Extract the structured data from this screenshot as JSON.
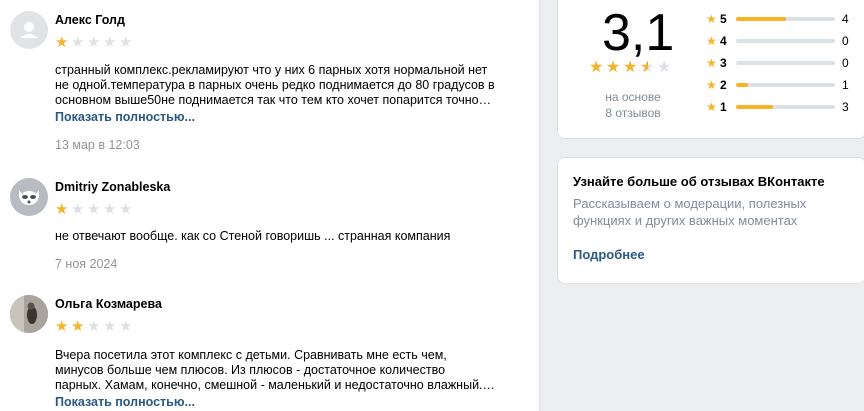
{
  "reviews": [
    {
      "author": "Алекс Голд",
      "rating": 1,
      "text": "странный комплекс.рекламируют что у них 6 парных хотя нормальной нет\nне одной.температура в парных очень редко поднимается до 80 градусов в\nосновном выше50не поднимается так что тем кто хочет попарится точно…",
      "more": "Показать полностью...",
      "date": "13 мар в 12:03"
    },
    {
      "author": "Dmitriy Zonableska",
      "rating": 1,
      "text": "не отвечают вообще. как со Стеной говоришь ... странная компания",
      "date": "7 ноя 2024"
    },
    {
      "author": "Ольга Козмарева",
      "rating": 2,
      "text": "Вчера посетила этот комплекс с детьми. Сравнивать мне есть чем,\nминусов больше чем плюсов. Из плюсов - достаточное количество\nпарных. Хамам, конечно, смешной - маленький и недостаточно влажный.…",
      "more": "Показать полностью..."
    }
  ],
  "summary": {
    "average": "3,1",
    "average_value": 3.1,
    "based_on": "на основе",
    "reviews_count": "8 отзывов",
    "distribution": [
      {
        "stars": "5",
        "count": "4",
        "fraction": 0.5
      },
      {
        "stars": "4",
        "count": "0",
        "fraction": 0
      },
      {
        "stars": "3",
        "count": "0",
        "fraction": 0
      },
      {
        "stars": "2",
        "count": "1",
        "fraction": 0.125
      },
      {
        "stars": "1",
        "count": "3",
        "fraction": 0.375
      }
    ]
  },
  "info": {
    "title": "Узнайте больше об отзывах ВКонтакте",
    "text": "Рассказываем о модерации, полезных\nфункциях и других важных моментах",
    "link": "Подробнее"
  },
  "colors": {
    "star": "#f5b325",
    "star_empty": "#dde1e6",
    "link": "#2a5885",
    "muted": "#818c99"
  }
}
